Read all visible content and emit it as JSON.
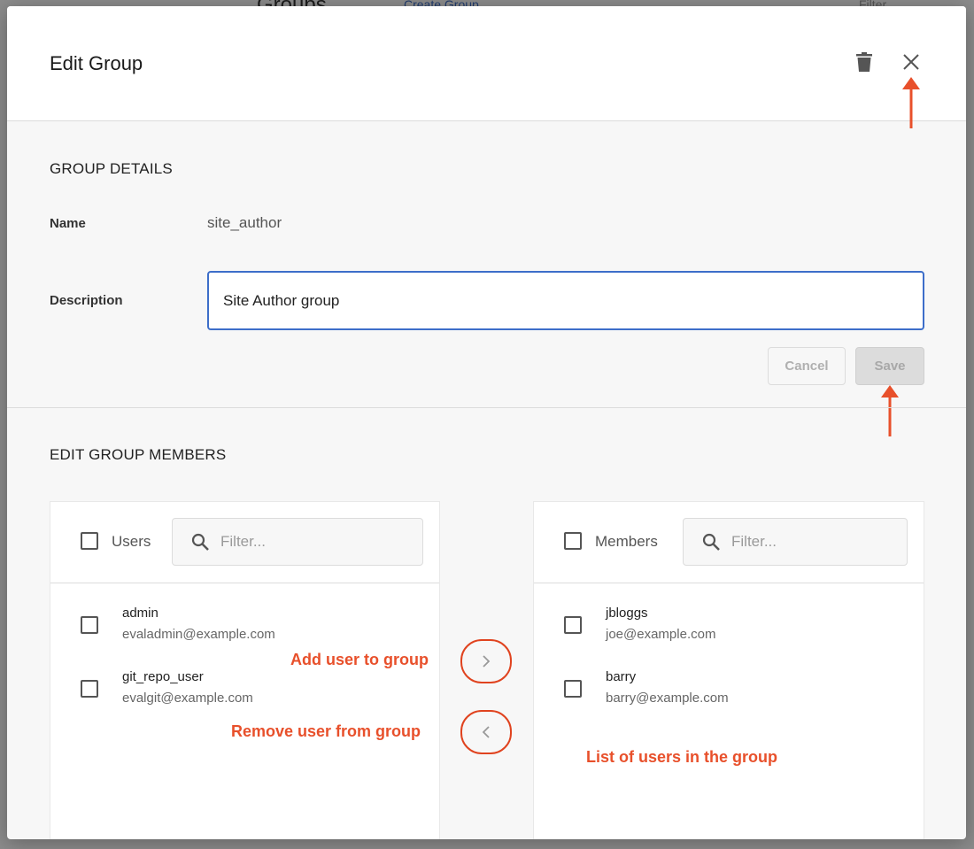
{
  "modal": {
    "title": "Edit Group",
    "group_details_title": "GROUP DETAILS",
    "name_label": "Name",
    "name_value": "site_author",
    "description_label": "Description",
    "description_value": "Site Author group",
    "cancel_label": "Cancel",
    "save_label": "Save",
    "edit_members_title": "EDIT GROUP MEMBERS"
  },
  "users_panel": {
    "header_label": "Users",
    "filter_placeholder": "Filter...",
    "items": [
      {
        "name": "admin",
        "email": "evaladmin@example.com"
      },
      {
        "name": "git_repo_user",
        "email": "evalgit@example.com"
      }
    ]
  },
  "members_panel": {
    "header_label": "Members",
    "filter_placeholder": "Filter...",
    "items": [
      {
        "name": "jbloggs",
        "email": "joe@example.com"
      },
      {
        "name": "barry",
        "email": "barry@example.com"
      }
    ]
  },
  "annotations": {
    "add_user": "Add user to group",
    "remove_user": "Remove user from group",
    "list_users": "List of users in the group"
  },
  "background": {
    "title_fragment": "Groups",
    "create_fragment": "Create Group",
    "filter_fragment": "Filter"
  },
  "icons": {
    "trash": "trash-icon",
    "close": "close-icon",
    "search": "search-icon",
    "add": "chevron-right-icon",
    "remove": "chevron-left-icon"
  },
  "colors": {
    "accent": "#3d6ec9",
    "annotation": "#e8502b"
  }
}
